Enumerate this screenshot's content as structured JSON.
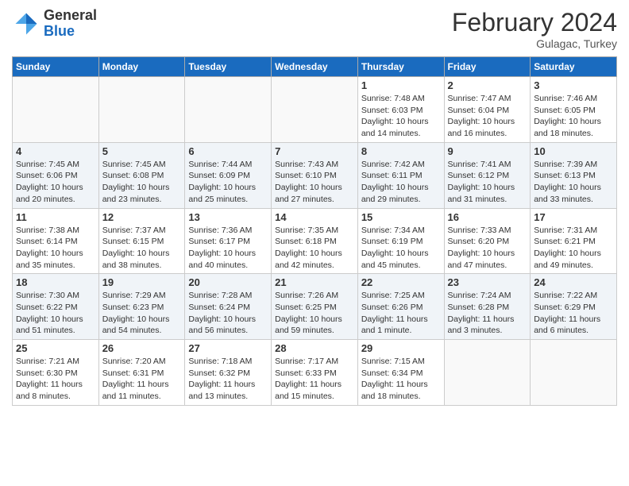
{
  "logo": {
    "general": "General",
    "blue": "Blue"
  },
  "header": {
    "title": "February 2024",
    "subtitle": "Gulagac, Turkey"
  },
  "days_of_week": [
    "Sunday",
    "Monday",
    "Tuesday",
    "Wednesday",
    "Thursday",
    "Friday",
    "Saturday"
  ],
  "weeks": [
    [
      {
        "day": "",
        "info": ""
      },
      {
        "day": "",
        "info": ""
      },
      {
        "day": "",
        "info": ""
      },
      {
        "day": "",
        "info": ""
      },
      {
        "day": "1",
        "info": "Sunrise: 7:48 AM\nSunset: 6:03 PM\nDaylight: 10 hours and 14 minutes."
      },
      {
        "day": "2",
        "info": "Sunrise: 7:47 AM\nSunset: 6:04 PM\nDaylight: 10 hours and 16 minutes."
      },
      {
        "day": "3",
        "info": "Sunrise: 7:46 AM\nSunset: 6:05 PM\nDaylight: 10 hours and 18 minutes."
      }
    ],
    [
      {
        "day": "4",
        "info": "Sunrise: 7:45 AM\nSunset: 6:06 PM\nDaylight: 10 hours and 20 minutes."
      },
      {
        "day": "5",
        "info": "Sunrise: 7:45 AM\nSunset: 6:08 PM\nDaylight: 10 hours and 23 minutes."
      },
      {
        "day": "6",
        "info": "Sunrise: 7:44 AM\nSunset: 6:09 PM\nDaylight: 10 hours and 25 minutes."
      },
      {
        "day": "7",
        "info": "Sunrise: 7:43 AM\nSunset: 6:10 PM\nDaylight: 10 hours and 27 minutes."
      },
      {
        "day": "8",
        "info": "Sunrise: 7:42 AM\nSunset: 6:11 PM\nDaylight: 10 hours and 29 minutes."
      },
      {
        "day": "9",
        "info": "Sunrise: 7:41 AM\nSunset: 6:12 PM\nDaylight: 10 hours and 31 minutes."
      },
      {
        "day": "10",
        "info": "Sunrise: 7:39 AM\nSunset: 6:13 PM\nDaylight: 10 hours and 33 minutes."
      }
    ],
    [
      {
        "day": "11",
        "info": "Sunrise: 7:38 AM\nSunset: 6:14 PM\nDaylight: 10 hours and 35 minutes."
      },
      {
        "day": "12",
        "info": "Sunrise: 7:37 AM\nSunset: 6:15 PM\nDaylight: 10 hours and 38 minutes."
      },
      {
        "day": "13",
        "info": "Sunrise: 7:36 AM\nSunset: 6:17 PM\nDaylight: 10 hours and 40 minutes."
      },
      {
        "day": "14",
        "info": "Sunrise: 7:35 AM\nSunset: 6:18 PM\nDaylight: 10 hours and 42 minutes."
      },
      {
        "day": "15",
        "info": "Sunrise: 7:34 AM\nSunset: 6:19 PM\nDaylight: 10 hours and 45 minutes."
      },
      {
        "day": "16",
        "info": "Sunrise: 7:33 AM\nSunset: 6:20 PM\nDaylight: 10 hours and 47 minutes."
      },
      {
        "day": "17",
        "info": "Sunrise: 7:31 AM\nSunset: 6:21 PM\nDaylight: 10 hours and 49 minutes."
      }
    ],
    [
      {
        "day": "18",
        "info": "Sunrise: 7:30 AM\nSunset: 6:22 PM\nDaylight: 10 hours and 51 minutes."
      },
      {
        "day": "19",
        "info": "Sunrise: 7:29 AM\nSunset: 6:23 PM\nDaylight: 10 hours and 54 minutes."
      },
      {
        "day": "20",
        "info": "Sunrise: 7:28 AM\nSunset: 6:24 PM\nDaylight: 10 hours and 56 minutes."
      },
      {
        "day": "21",
        "info": "Sunrise: 7:26 AM\nSunset: 6:25 PM\nDaylight: 10 hours and 59 minutes."
      },
      {
        "day": "22",
        "info": "Sunrise: 7:25 AM\nSunset: 6:26 PM\nDaylight: 11 hours and 1 minute."
      },
      {
        "day": "23",
        "info": "Sunrise: 7:24 AM\nSunset: 6:28 PM\nDaylight: 11 hours and 3 minutes."
      },
      {
        "day": "24",
        "info": "Sunrise: 7:22 AM\nSunset: 6:29 PM\nDaylight: 11 hours and 6 minutes."
      }
    ],
    [
      {
        "day": "25",
        "info": "Sunrise: 7:21 AM\nSunset: 6:30 PM\nDaylight: 11 hours and 8 minutes."
      },
      {
        "day": "26",
        "info": "Sunrise: 7:20 AM\nSunset: 6:31 PM\nDaylight: 11 hours and 11 minutes."
      },
      {
        "day": "27",
        "info": "Sunrise: 7:18 AM\nSunset: 6:32 PM\nDaylight: 11 hours and 13 minutes."
      },
      {
        "day": "28",
        "info": "Sunrise: 7:17 AM\nSunset: 6:33 PM\nDaylight: 11 hours and 15 minutes."
      },
      {
        "day": "29",
        "info": "Sunrise: 7:15 AM\nSunset: 6:34 PM\nDaylight: 11 hours and 18 minutes."
      },
      {
        "day": "",
        "info": ""
      },
      {
        "day": "",
        "info": ""
      }
    ]
  ]
}
